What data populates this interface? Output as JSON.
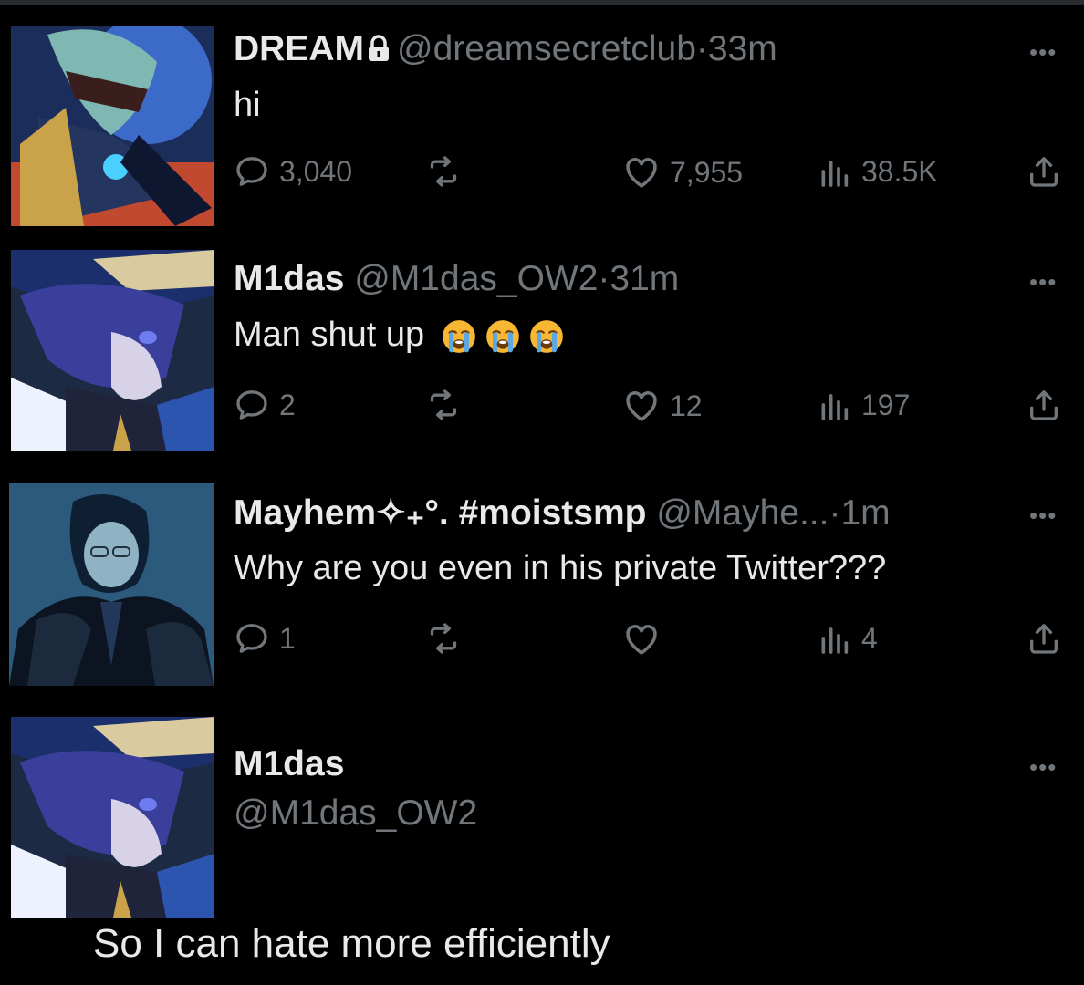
{
  "tweets": [
    {
      "name": "DREAM",
      "handle": "@dreamsecretclub",
      "time": "33m",
      "text": "hi",
      "replies": "3,040",
      "likes": "7,955",
      "views": "38.5K",
      "protected": true
    },
    {
      "name": "M1das",
      "handle": "@M1das_OW2",
      "time": "31m",
      "text": "Man shut up",
      "emoji": [
        "loudly-crying-face",
        "loudly-crying-face",
        "loudly-crying-face"
      ],
      "replies": "2",
      "likes": "12",
      "views": "197"
    },
    {
      "name": "Mayhem✧₊°. #moistsmp",
      "handle": "@Mayhe...",
      "time": "1m",
      "text": "Why are you even in his private Twitter???",
      "replies": "1",
      "likes": "",
      "views": "4"
    },
    {
      "name": "M1das",
      "handle": "@M1das_OW2"
    }
  ],
  "caption": "So I can hate more efficiently",
  "more_label": "•••",
  "dot": "·",
  "icons": {
    "reply": "reply-bubble-icon",
    "retweet": "retweet-icon",
    "like": "heart-icon",
    "views": "views-bar-icon",
    "share": "share-icon",
    "lock": "lock-icon",
    "more": "more-dots-icon"
  },
  "colors": {
    "background": "#000000",
    "text": "#e7e9ea",
    "muted": "#71767b"
  }
}
